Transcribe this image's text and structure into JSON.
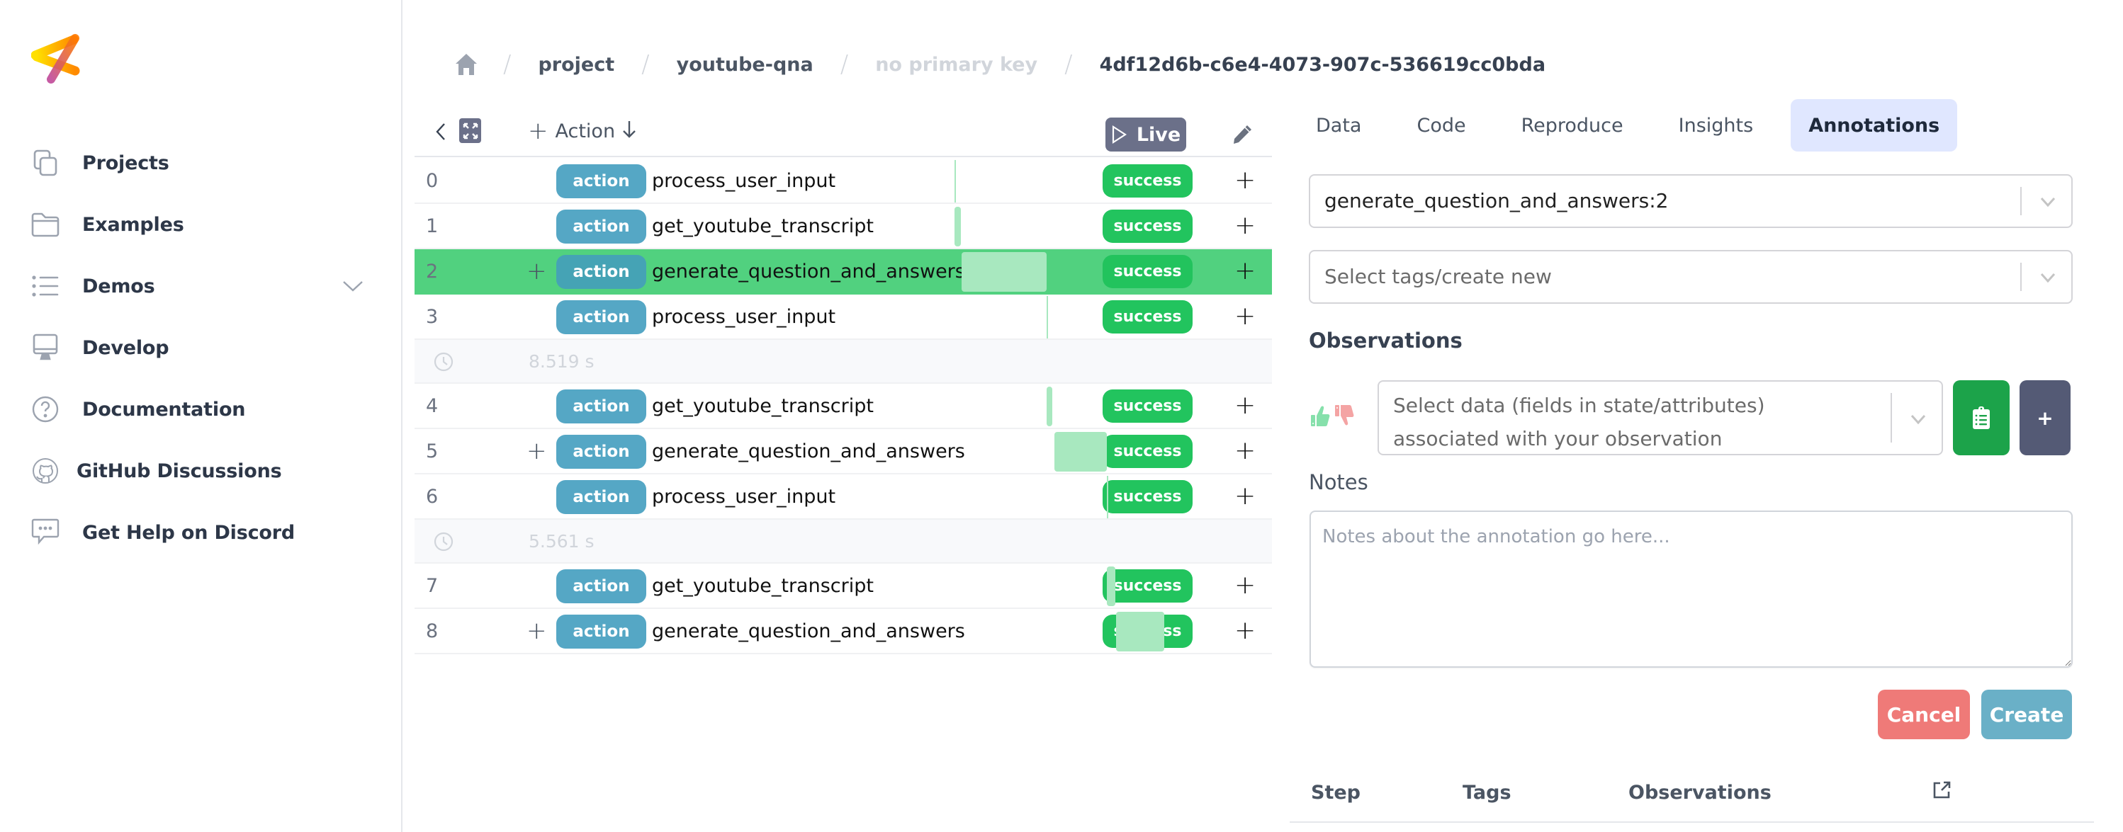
{
  "sidebar": {
    "logo": "burr-logo",
    "items": [
      {
        "label": "Projects",
        "icon": "copy-icon"
      },
      {
        "label": "Examples",
        "icon": "folder-icon"
      },
      {
        "label": "Demos",
        "icon": "list-icon",
        "expandable": true
      },
      {
        "label": "Develop",
        "icon": "monitor-icon"
      },
      {
        "label": "Documentation",
        "icon": "question-circle-icon"
      },
      {
        "label": "GitHub Discussions",
        "icon": "github-icon"
      },
      {
        "label": "Get Help on Discord",
        "icon": "chat-bubble-icon"
      }
    ]
  },
  "breadcrumb": {
    "home_icon": "home-icon",
    "items": [
      "project",
      "youtube-qna",
      "no primary key",
      "4df12d6b-c6e4-4073-907c-536619cc0bda"
    ]
  },
  "steps_toolbar": {
    "action_label": "Action",
    "live_label": "Live"
  },
  "steps": {
    "rows": [
      {
        "type": "step",
        "index": "0",
        "tag": "action",
        "name": "process_user_input",
        "status": "success",
        "expandable": false,
        "selected": false,
        "bar_start": 0.0,
        "bar_len": 0.001
      },
      {
        "type": "step",
        "index": "1",
        "tag": "action",
        "name": "get_youtube_transcript",
        "status": "success",
        "expandable": false,
        "selected": false,
        "bar_start": 0.0,
        "bar_len": 0.03
      },
      {
        "type": "step",
        "index": "2",
        "tag": "action",
        "name": "generate_question_and_answers",
        "status": "success",
        "expandable": true,
        "selected": true,
        "bar_start": 0.035,
        "bar_len": 0.42
      },
      {
        "type": "step",
        "index": "3",
        "tag": "action",
        "name": "process_user_input",
        "status": "success",
        "expandable": false,
        "selected": false,
        "bar_start": 0.455,
        "bar_len": 0.001
      },
      {
        "type": "gap",
        "duration": "8.519 s"
      },
      {
        "type": "step",
        "index": "4",
        "tag": "action",
        "name": "get_youtube_transcript",
        "status": "success",
        "expandable": false,
        "selected": false,
        "bar_start": 0.455,
        "bar_len": 0.03
      },
      {
        "type": "step",
        "index": "5",
        "tag": "action",
        "name": "generate_question_and_answers",
        "status": "success",
        "expandable": true,
        "selected": false,
        "bar_start": 0.495,
        "bar_len": 0.26
      },
      {
        "type": "step",
        "index": "6",
        "tag": "action",
        "name": "process_user_input",
        "status": "success",
        "expandable": false,
        "selected": false,
        "bar_start": 0.755,
        "bar_len": 0.001
      },
      {
        "type": "gap",
        "duration": "5.561 s"
      },
      {
        "type": "step",
        "index": "7",
        "tag": "action",
        "name": "get_youtube_transcript",
        "status": "success",
        "expandable": false,
        "selected": false,
        "bar_start": 0.755,
        "bar_len": 0.04
      },
      {
        "type": "step",
        "index": "8",
        "tag": "action",
        "name": "generate_question_and_answers",
        "status": "success",
        "expandable": true,
        "selected": false,
        "bar_start": 0.8,
        "bar_len": 0.24
      }
    ]
  },
  "tabs": [
    {
      "label": "Data",
      "active": false
    },
    {
      "label": "Code",
      "active": false
    },
    {
      "label": "Reproduce",
      "active": false
    },
    {
      "label": "Insights",
      "active": false
    },
    {
      "label": "Annotations",
      "active": true
    }
  ],
  "annotations": {
    "step_select_value": "generate_question_and_answers:2",
    "tags_placeholder": "Select tags/create new",
    "observations_title": "Observations",
    "observation_placeholder": "Select data (fields in state/attributes) associated with your observation",
    "add_observation_label": "+",
    "notes_label": "Notes",
    "notes_placeholder": "Notes about the annotation go here...",
    "notes_value": "",
    "cancel_label": "Cancel",
    "create_label": "Create",
    "table_headers": [
      "Step",
      "Tags",
      "Observations"
    ]
  },
  "colors": {
    "action_tag": "#55a7c5",
    "success": "#22c45e",
    "selected_row": "#51d17f",
    "duration_bar": "#a8e8bf",
    "live_button": "#6b7089",
    "active_tab": "#e0e7ff",
    "cancel": "#ef7a78",
    "create": "#6ab0c7",
    "observation_green": "#1ca34a",
    "observation_add": "#545a75"
  }
}
